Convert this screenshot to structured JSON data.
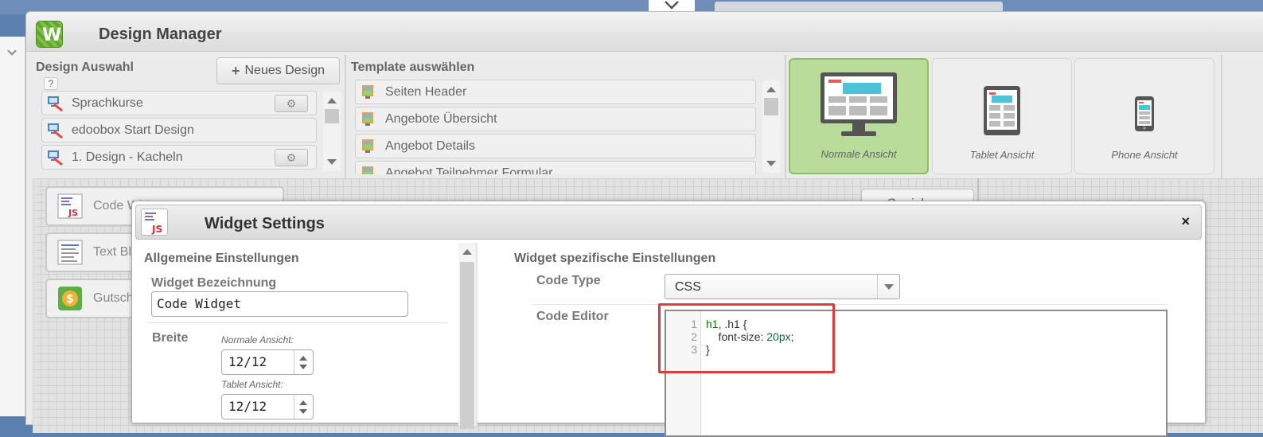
{
  "design_manager": {
    "title": "Design Manager",
    "logo_letter": "W",
    "design_section": {
      "label": "Design Auswahl",
      "help": "?",
      "new_button": "Neues Design",
      "items": [
        {
          "label": "Sprachkurse",
          "has_gear": true
        },
        {
          "label": "edoobox Start Design",
          "has_gear": false
        },
        {
          "label": "1. Design - Kacheln",
          "has_gear": true
        }
      ]
    },
    "template_section": {
      "label": "Template auswählen",
      "items": [
        {
          "label": "Seiten Header"
        },
        {
          "label": "Angebote Übersicht"
        },
        {
          "label": "Angebot Details"
        },
        {
          "label": "Angebot Teilnehmer Formular"
        }
      ]
    },
    "views": [
      {
        "label": "Normale Ansicht",
        "active": true
      },
      {
        "label": "Tablet Ansicht",
        "active": false
      },
      {
        "label": "Phone Ansicht",
        "active": false
      }
    ],
    "widgets": [
      {
        "label": "Code Widget"
      },
      {
        "label": "Text Block"
      },
      {
        "label": "Gutschein"
      }
    ],
    "save_button": "Speichern"
  },
  "widget_settings": {
    "title": "Widget Settings",
    "close": "×",
    "general": {
      "heading": "Allgemeine Einstellungen",
      "name_label": "Widget Bezeichnung",
      "name_value": "Code Widget",
      "width_label": "Breite",
      "normal_label": "Normale Ansicht:",
      "normal_value": "12/12",
      "tablet_label": "Tablet Ansicht:",
      "tablet_value": "12/12"
    },
    "specific": {
      "heading": "Widget spezifische Einstellungen",
      "code_type_label": "Code Type",
      "code_type_value": "CSS",
      "code_editor_label": "Code Editor",
      "line_numbers": [
        "1",
        "2",
        "3"
      ],
      "code": {
        "line1_selector": "h1",
        "line1_rest": ", .h1 {",
        "line2_prop": "    font-size: ",
        "line2_value": "20px",
        "line2_end": ";",
        "line3": "}"
      }
    }
  },
  "colors": {
    "accent_green": "#b9dc9b",
    "highlight_red": "#e03a3a"
  }
}
